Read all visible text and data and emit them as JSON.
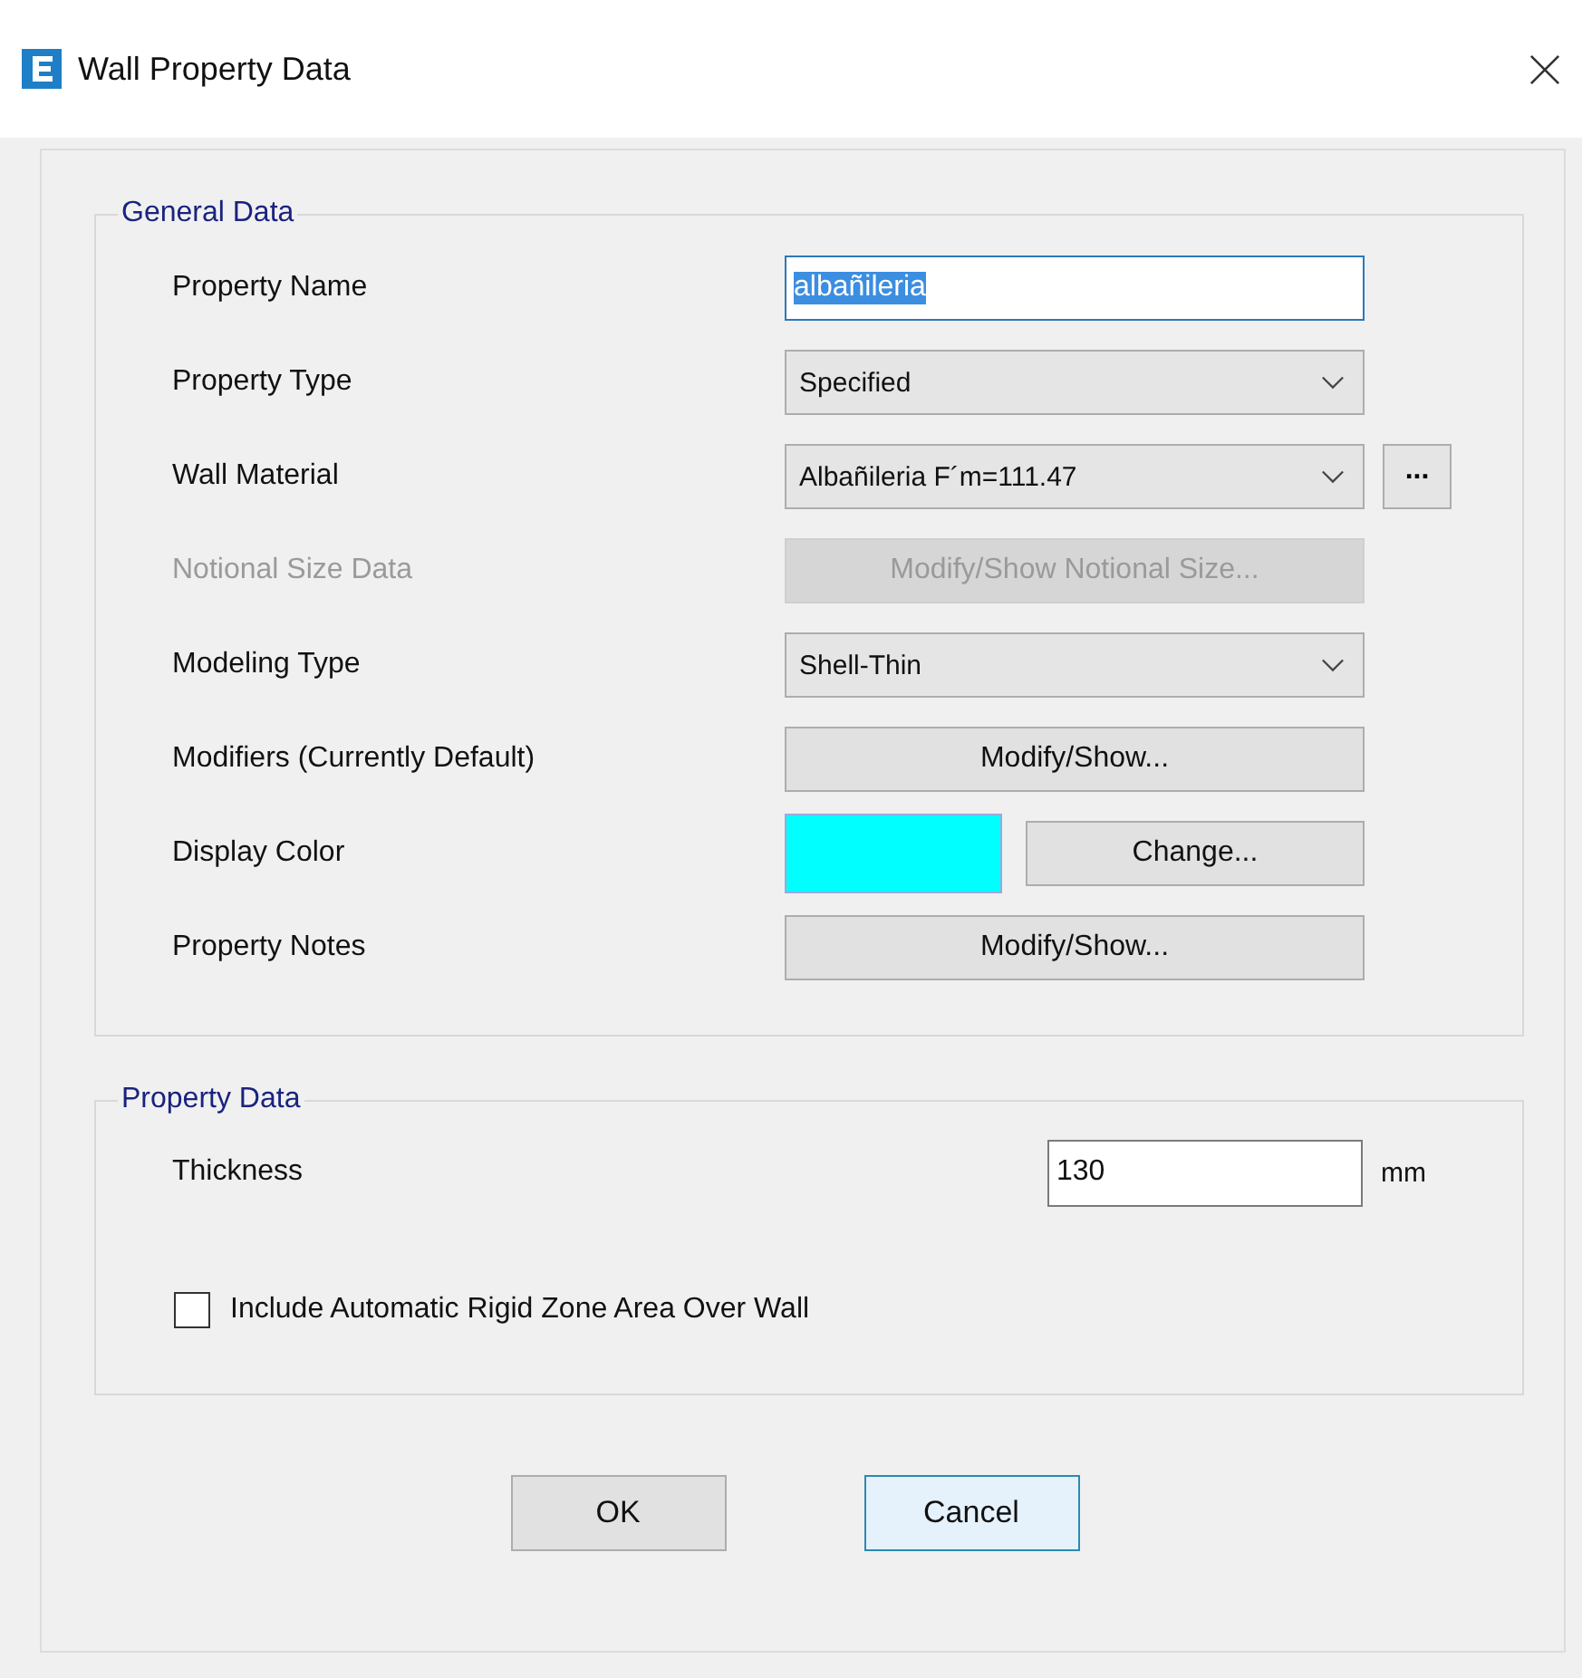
{
  "window": {
    "title": "Wall Property Data"
  },
  "general_data": {
    "title": "General Data",
    "rows": [
      {
        "kind": "text",
        "label": "Property Name",
        "value": "albañileria",
        "text_selected": true,
        "disabled": false
      },
      {
        "kind": "dropdown",
        "label": "Property Type",
        "value": "Specified",
        "disabled": false
      },
      {
        "kind": "dropdown",
        "label": "Wall Material",
        "value": "Albañileria F´m=111.47",
        "extra_button": "...",
        "disabled": false
      },
      {
        "kind": "button",
        "label": "Notional Size Data",
        "button": "Modify/Show Notional Size...",
        "disabled": true
      },
      {
        "kind": "dropdown",
        "label": "Modeling Type",
        "value": "Shell-Thin",
        "disabled": false
      },
      {
        "kind": "button",
        "label": "Modifiers (Currently Default)",
        "button": "Modify/Show...",
        "disabled": false
      },
      {
        "kind": "color",
        "label": "Display Color",
        "color": "#00ffff",
        "button": "Change...",
        "disabled": false
      },
      {
        "kind": "button",
        "label": "Property Notes",
        "button": "Modify/Show...",
        "disabled": false
      }
    ]
  },
  "property_data": {
    "title": "Property Data",
    "thickness": {
      "label": "Thickness",
      "value": "130",
      "unit": "mm"
    },
    "checkbox": {
      "label": "Include Automatic Rigid Zone Area Over Wall",
      "checked": false
    }
  },
  "buttons": [
    {
      "label": "OK",
      "focused": false
    },
    {
      "label": "Cancel",
      "focused": true
    }
  ]
}
